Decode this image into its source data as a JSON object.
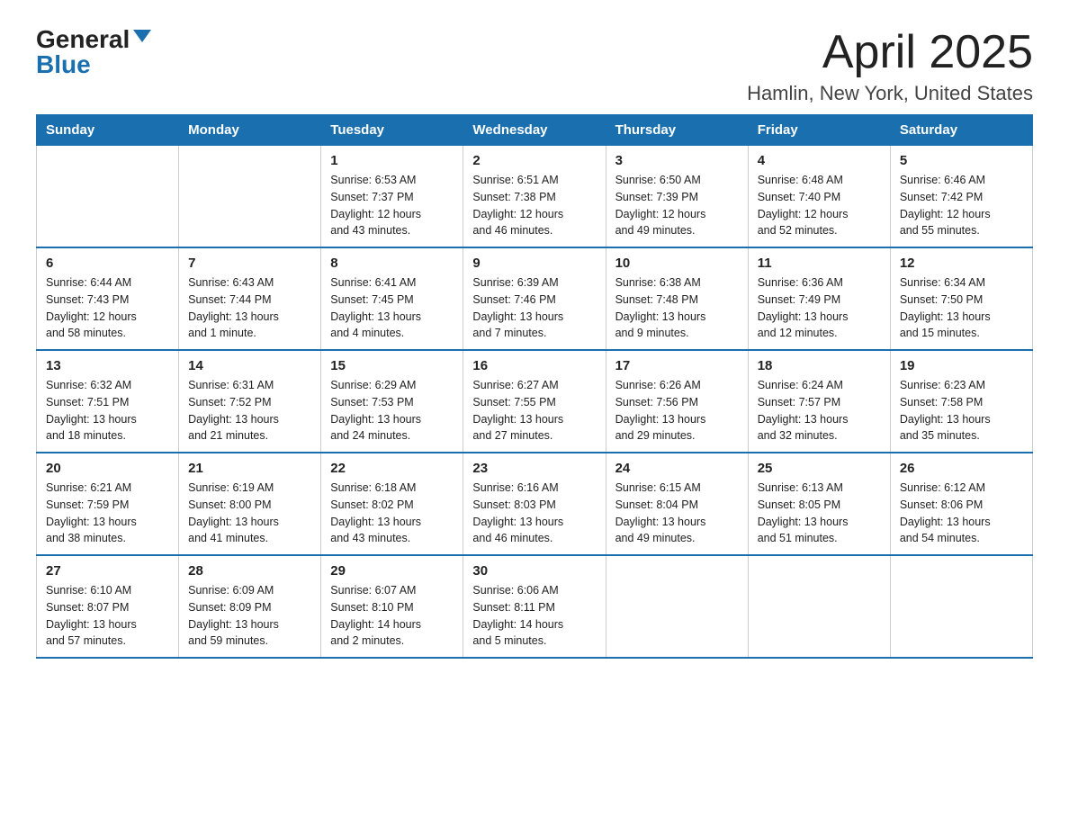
{
  "logo": {
    "general": "General",
    "blue": "Blue"
  },
  "title": "April 2025",
  "subtitle": "Hamlin, New York, United States",
  "days_of_week": [
    "Sunday",
    "Monday",
    "Tuesday",
    "Wednesday",
    "Thursday",
    "Friday",
    "Saturday"
  ],
  "weeks": [
    [
      {
        "day": "",
        "info": ""
      },
      {
        "day": "",
        "info": ""
      },
      {
        "day": "1",
        "info": "Sunrise: 6:53 AM\nSunset: 7:37 PM\nDaylight: 12 hours\nand 43 minutes."
      },
      {
        "day": "2",
        "info": "Sunrise: 6:51 AM\nSunset: 7:38 PM\nDaylight: 12 hours\nand 46 minutes."
      },
      {
        "day": "3",
        "info": "Sunrise: 6:50 AM\nSunset: 7:39 PM\nDaylight: 12 hours\nand 49 minutes."
      },
      {
        "day": "4",
        "info": "Sunrise: 6:48 AM\nSunset: 7:40 PM\nDaylight: 12 hours\nand 52 minutes."
      },
      {
        "day": "5",
        "info": "Sunrise: 6:46 AM\nSunset: 7:42 PM\nDaylight: 12 hours\nand 55 minutes."
      }
    ],
    [
      {
        "day": "6",
        "info": "Sunrise: 6:44 AM\nSunset: 7:43 PM\nDaylight: 12 hours\nand 58 minutes."
      },
      {
        "day": "7",
        "info": "Sunrise: 6:43 AM\nSunset: 7:44 PM\nDaylight: 13 hours\nand 1 minute."
      },
      {
        "day": "8",
        "info": "Sunrise: 6:41 AM\nSunset: 7:45 PM\nDaylight: 13 hours\nand 4 minutes."
      },
      {
        "day": "9",
        "info": "Sunrise: 6:39 AM\nSunset: 7:46 PM\nDaylight: 13 hours\nand 7 minutes."
      },
      {
        "day": "10",
        "info": "Sunrise: 6:38 AM\nSunset: 7:48 PM\nDaylight: 13 hours\nand 9 minutes."
      },
      {
        "day": "11",
        "info": "Sunrise: 6:36 AM\nSunset: 7:49 PM\nDaylight: 13 hours\nand 12 minutes."
      },
      {
        "day": "12",
        "info": "Sunrise: 6:34 AM\nSunset: 7:50 PM\nDaylight: 13 hours\nand 15 minutes."
      }
    ],
    [
      {
        "day": "13",
        "info": "Sunrise: 6:32 AM\nSunset: 7:51 PM\nDaylight: 13 hours\nand 18 minutes."
      },
      {
        "day": "14",
        "info": "Sunrise: 6:31 AM\nSunset: 7:52 PM\nDaylight: 13 hours\nand 21 minutes."
      },
      {
        "day": "15",
        "info": "Sunrise: 6:29 AM\nSunset: 7:53 PM\nDaylight: 13 hours\nand 24 minutes."
      },
      {
        "day": "16",
        "info": "Sunrise: 6:27 AM\nSunset: 7:55 PM\nDaylight: 13 hours\nand 27 minutes."
      },
      {
        "day": "17",
        "info": "Sunrise: 6:26 AM\nSunset: 7:56 PM\nDaylight: 13 hours\nand 29 minutes."
      },
      {
        "day": "18",
        "info": "Sunrise: 6:24 AM\nSunset: 7:57 PM\nDaylight: 13 hours\nand 32 minutes."
      },
      {
        "day": "19",
        "info": "Sunrise: 6:23 AM\nSunset: 7:58 PM\nDaylight: 13 hours\nand 35 minutes."
      }
    ],
    [
      {
        "day": "20",
        "info": "Sunrise: 6:21 AM\nSunset: 7:59 PM\nDaylight: 13 hours\nand 38 minutes."
      },
      {
        "day": "21",
        "info": "Sunrise: 6:19 AM\nSunset: 8:00 PM\nDaylight: 13 hours\nand 41 minutes."
      },
      {
        "day": "22",
        "info": "Sunrise: 6:18 AM\nSunset: 8:02 PM\nDaylight: 13 hours\nand 43 minutes."
      },
      {
        "day": "23",
        "info": "Sunrise: 6:16 AM\nSunset: 8:03 PM\nDaylight: 13 hours\nand 46 minutes."
      },
      {
        "day": "24",
        "info": "Sunrise: 6:15 AM\nSunset: 8:04 PM\nDaylight: 13 hours\nand 49 minutes."
      },
      {
        "day": "25",
        "info": "Sunrise: 6:13 AM\nSunset: 8:05 PM\nDaylight: 13 hours\nand 51 minutes."
      },
      {
        "day": "26",
        "info": "Sunrise: 6:12 AM\nSunset: 8:06 PM\nDaylight: 13 hours\nand 54 minutes."
      }
    ],
    [
      {
        "day": "27",
        "info": "Sunrise: 6:10 AM\nSunset: 8:07 PM\nDaylight: 13 hours\nand 57 minutes."
      },
      {
        "day": "28",
        "info": "Sunrise: 6:09 AM\nSunset: 8:09 PM\nDaylight: 13 hours\nand 59 minutes."
      },
      {
        "day": "29",
        "info": "Sunrise: 6:07 AM\nSunset: 8:10 PM\nDaylight: 14 hours\nand 2 minutes."
      },
      {
        "day": "30",
        "info": "Sunrise: 6:06 AM\nSunset: 8:11 PM\nDaylight: 14 hours\nand 5 minutes."
      },
      {
        "day": "",
        "info": ""
      },
      {
        "day": "",
        "info": ""
      },
      {
        "day": "",
        "info": ""
      }
    ]
  ]
}
